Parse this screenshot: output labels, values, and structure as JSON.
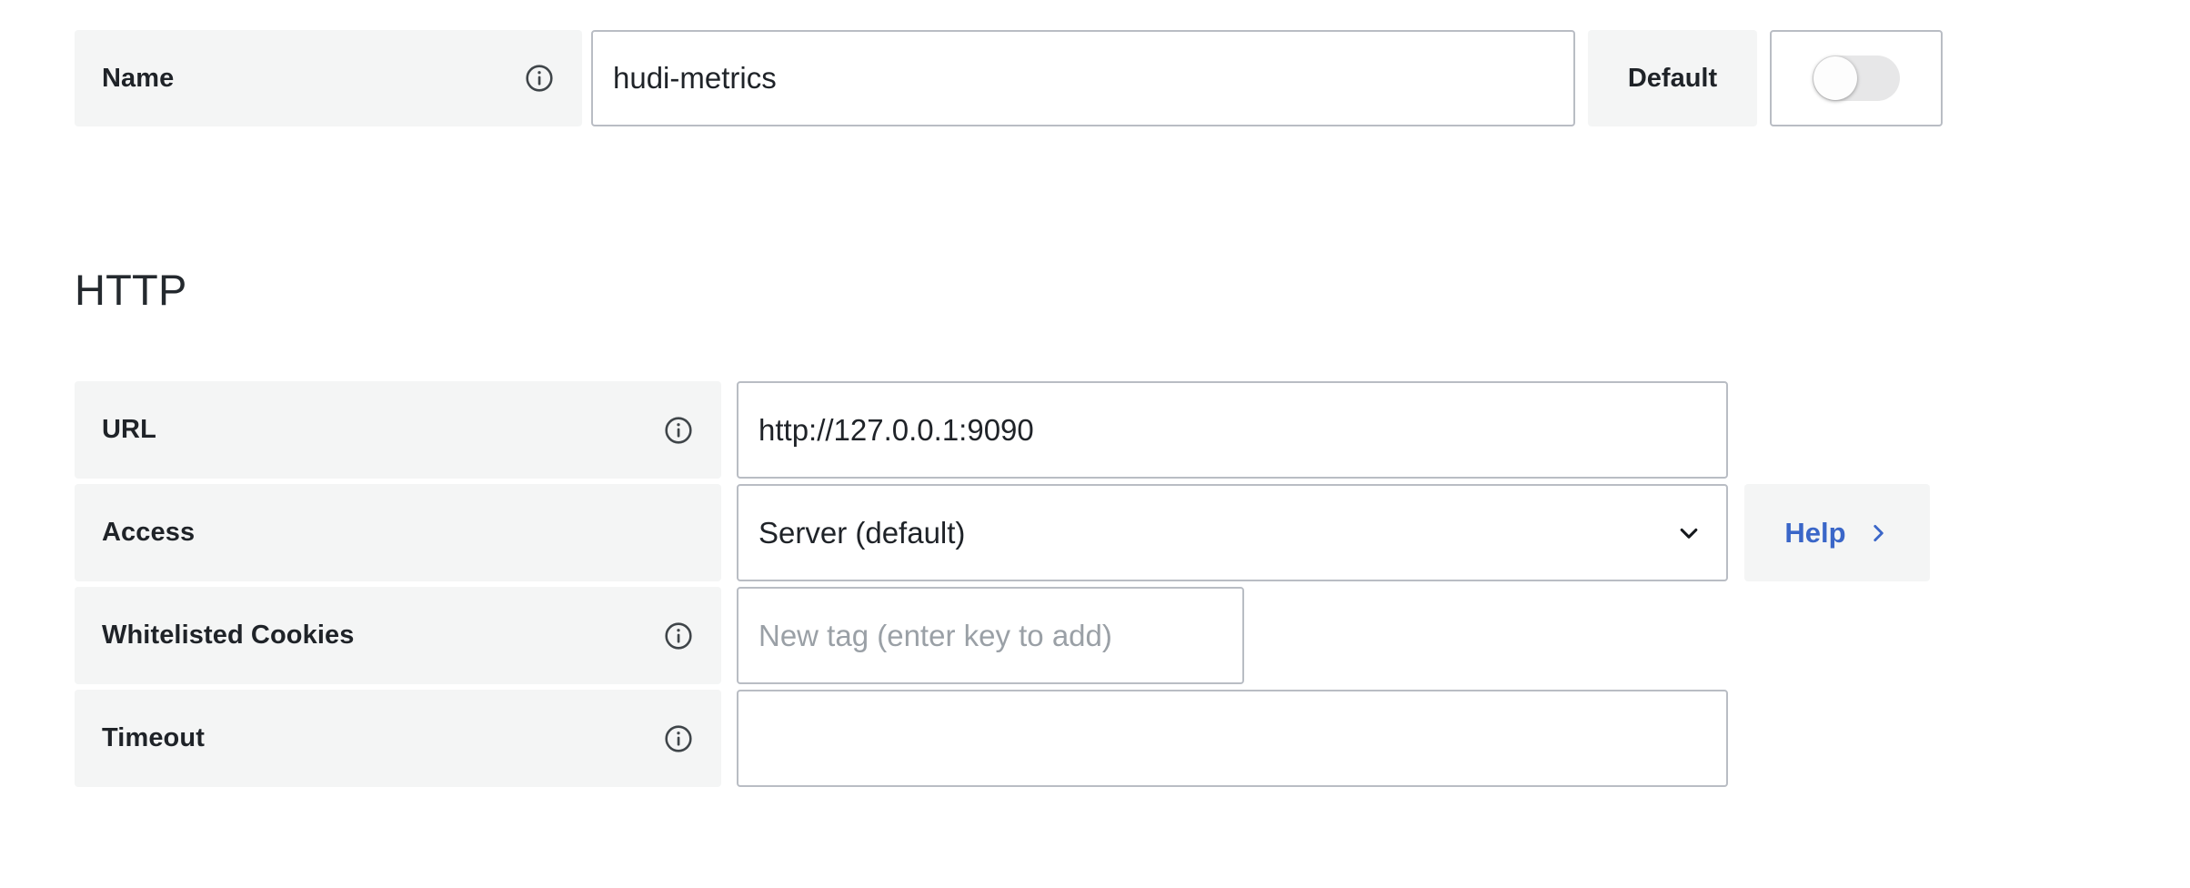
{
  "name_row": {
    "label": "Name",
    "info_icon": "info-circle-icon",
    "value": "hudi-metrics",
    "default_label": "Default",
    "toggle": {
      "name": "default-toggle",
      "state": "off"
    }
  },
  "http_section": {
    "title": "HTTP",
    "fields": [
      {
        "label": "URL",
        "info_icon": "info-circle-icon",
        "value": "http://127.0.0.1:9090",
        "placeholder": ""
      },
      {
        "label": "Access",
        "info_icon": null,
        "value": "Server (default)",
        "chevron_icon": "chevron-down-icon"
      },
      {
        "label": "Whitelisted Cookies",
        "info_icon": "info-circle-icon",
        "value": "",
        "placeholder": "New tag (enter key to add)"
      },
      {
        "label": "Timeout",
        "info_icon": "info-circle-icon",
        "value": "",
        "placeholder": ""
      }
    ],
    "help": {
      "label": "Help",
      "chevron_icon": "chevron-right-icon"
    }
  },
  "colors": {
    "label_background": "#f4f5f5",
    "input_border": "#b9bdc4",
    "text": "#1f2328",
    "link": "#3a66c8",
    "placeholder": "#9aa0a6",
    "toggle_track_off": "#e7e7e8",
    "page_background": "#ffffff"
  }
}
